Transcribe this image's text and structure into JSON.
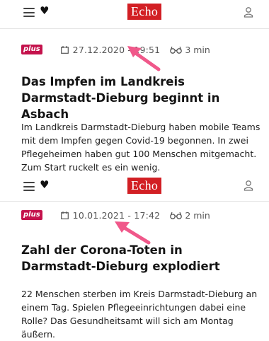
{
  "articles": [
    {
      "header": {
        "logo": "Echo",
        "menu_icon": "hamburger-menu-icon",
        "favorites_icon": "heart-icon",
        "account_icon": "user-icon"
      },
      "badge": "plus",
      "date": "27.12.2020 - 19:51",
      "read_time": "3 min",
      "headline": "Das Impfen im Landkreis Darmstadt-Dieburg beginnt in Asbach",
      "teaser": "Im Landkreis Darmstadt-Dieburg haben mobile Teams mit dem Impfen gegen Covid-19 begonnen. In zwei Pflegeheimen haben gut 100 Menschen mitgemacht. Zum Start ruckelt es ein wenig."
    },
    {
      "header": {
        "logo": "Echo",
        "menu_icon": "hamburger-menu-icon",
        "favorites_icon": "heart-icon",
        "account_icon": "user-icon"
      },
      "badge": "plus",
      "date": "10.01.2021 - 17:42",
      "read_time": "2 min",
      "headline": "Zahl der Corona-Toten in Darmstadt-Dieburg explodiert",
      "teaser": "22 Menschen sterben im Kreis Darmstadt-Dieburg an einem Tag. Spielen Pflegeeinrichtungen dabei eine Rolle? Das Gesundheitsamt will sich am Montag äußern."
    }
  ],
  "colors": {
    "brand_red": "#d21f24",
    "plus_badge": "#c4124c",
    "annotation_arrow": "#f0588a"
  }
}
